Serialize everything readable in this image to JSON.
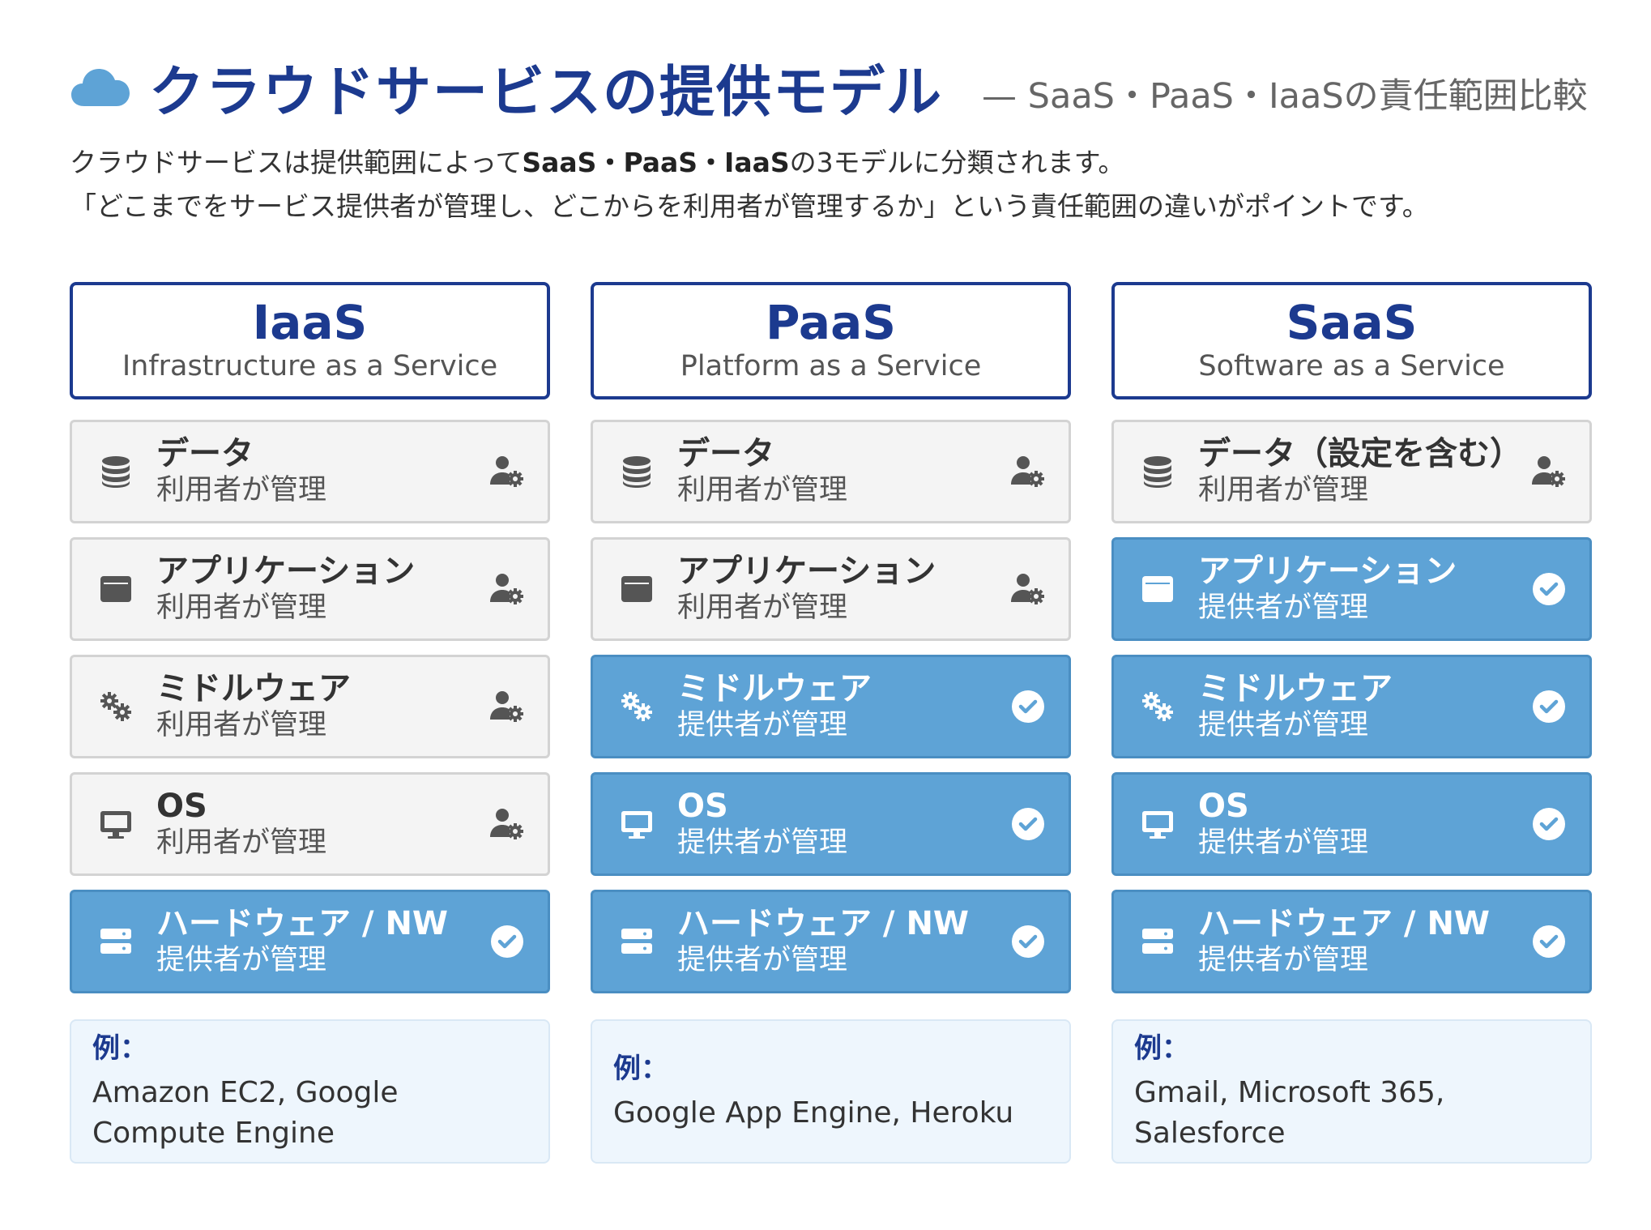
{
  "header": {
    "title": "クラウドサービスの提供モデル",
    "subtitle": "— SaaS・PaaS・IaaSの責任範囲比較",
    "desc_line1_a": "クラウドサービスは提供範囲によって",
    "desc_line1_b": "SaaS・PaaS・IaaS",
    "desc_line1_c": "の3モデルに分類されます。",
    "desc_line2": "「どこまでをサービス提供者が管理し、どこからを利用者が管理するか」という責任範囲の違いがポイントです。"
  },
  "colors": {
    "navy": "#1c3a8f",
    "provider_blue": "#5ea3d6",
    "user_gray": "#f4f4f4",
    "example_bg": "#eef6fd"
  },
  "columns": [
    {
      "abbr": "IaaS",
      "full": "Infrastructure as a Service",
      "layers": [
        {
          "name": "データ",
          "owner": "利用者が管理",
          "icon": "database-icon",
          "type": "user"
        },
        {
          "name": "アプリケーション",
          "owner": "利用者が管理",
          "icon": "window-icon",
          "type": "user"
        },
        {
          "name": "ミドルウェア",
          "owner": "利用者が管理",
          "icon": "gears-icon",
          "type": "user"
        },
        {
          "name": "OS",
          "owner": "利用者が管理",
          "icon": "monitor-icon",
          "type": "user"
        },
        {
          "name": "ハードウェア / NW",
          "owner": "提供者が管理",
          "icon": "server-icon",
          "type": "provider"
        }
      ],
      "example_label": "例：",
      "example_text": "Amazon EC2, Google Compute Engine"
    },
    {
      "abbr": "PaaS",
      "full": "Platform as a Service",
      "layers": [
        {
          "name": "データ",
          "owner": "利用者が管理",
          "icon": "database-icon",
          "type": "user"
        },
        {
          "name": "アプリケーション",
          "owner": "利用者が管理",
          "icon": "window-icon",
          "type": "user"
        },
        {
          "name": "ミドルウェア",
          "owner": "提供者が管理",
          "icon": "gears-icon",
          "type": "provider"
        },
        {
          "name": "OS",
          "owner": "提供者が管理",
          "icon": "monitor-icon",
          "type": "provider"
        },
        {
          "name": "ハードウェア / NW",
          "owner": "提供者が管理",
          "icon": "server-icon",
          "type": "provider"
        }
      ],
      "example_label": "例：",
      "example_text": "Google App Engine, Heroku"
    },
    {
      "abbr": "SaaS",
      "full": "Software as a Service",
      "layers": [
        {
          "name": "データ（設定を含む）",
          "owner": "利用者が管理",
          "icon": "database-icon",
          "type": "user"
        },
        {
          "name": "アプリケーション",
          "owner": "提供者が管理",
          "icon": "window-icon",
          "type": "provider"
        },
        {
          "name": "ミドルウェア",
          "owner": "提供者が管理",
          "icon": "gears-icon",
          "type": "provider"
        },
        {
          "name": "OS",
          "owner": "提供者が管理",
          "icon": "monitor-icon",
          "type": "provider"
        },
        {
          "name": "ハードウェア / NW",
          "owner": "提供者が管理",
          "icon": "server-icon",
          "type": "provider"
        }
      ],
      "example_label": "例：",
      "example_text": "Gmail, Microsoft 365, Salesforce"
    }
  ]
}
